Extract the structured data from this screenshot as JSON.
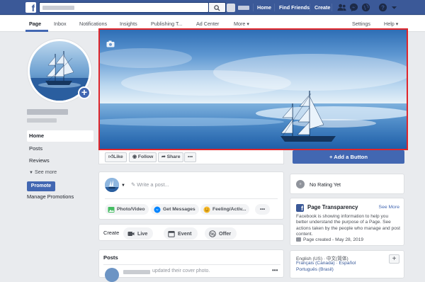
{
  "topbar": {
    "nav": [
      "Home",
      "Find Friends",
      "Create"
    ]
  },
  "section_nav": {
    "tabs": [
      "Page",
      "Inbox",
      "Notifications",
      "Insights",
      "Publishing T...",
      "Ad Center",
      "More ▾"
    ],
    "right": [
      "Settings",
      "Help ▾"
    ]
  },
  "left_nav": {
    "items": [
      "Home",
      "Posts",
      "Reviews"
    ],
    "see_more": "See more",
    "promote": "Promote",
    "manage_promotions": "Manage Promotions"
  },
  "actions": {
    "like": "Like",
    "follow": "Follow",
    "share": "Share",
    "more": "•••",
    "add_button": "+ Add a Button"
  },
  "composer": {
    "placeholder": "Write a post...",
    "pills": [
      "Photo/Video",
      "Get Messages",
      "Feeling/Activ...",
      "•••"
    ]
  },
  "create": {
    "label": "Create",
    "buttons": [
      "Live",
      "Event",
      "Offer"
    ]
  },
  "posts": {
    "title": "Posts",
    "preview_text": "updated their cover photo.",
    "more": "•••"
  },
  "rating": {
    "text": "No Rating Yet"
  },
  "transparency": {
    "title": "Page Transparency",
    "see_more": "See More",
    "description": "Facebook is showing information to help you better understand the purpose of a Page. See actions taken by the people who manage and post content.",
    "created": "Page created - May 28, 2019"
  },
  "languages": {
    "current": "English (US) · 中文(简体)",
    "line2": "Français (Canada) · Español",
    "line3": "Português (Brasil)",
    "plus": "+"
  },
  "colors": {
    "brand": "#3b5998",
    "accent": "#4267b2",
    "highlight_border": "#e0252a"
  }
}
